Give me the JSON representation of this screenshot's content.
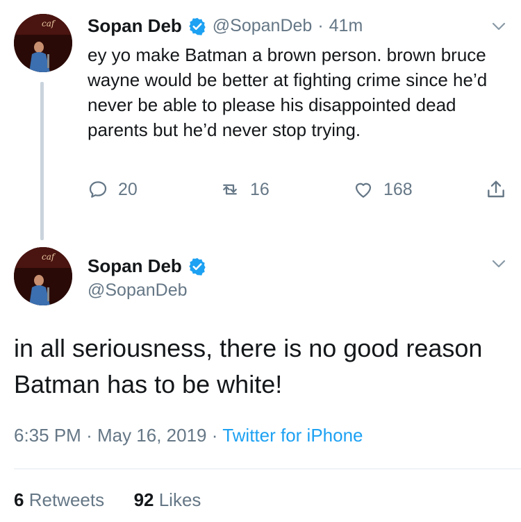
{
  "tweet1": {
    "name": "Sopan Deb",
    "handle": "@SopanDeb",
    "separator": "·",
    "time": "41m",
    "text": "ey yo make Batman a brown person. brown bruce wayne would be better at fighting crime since he’d never be able to please his disappointed dead parents but he’d never stop trying.",
    "replies": "20",
    "retweets": "16",
    "likes": "168"
  },
  "tweet2": {
    "name": "Sopan Deb",
    "handle": "@SopanDeb",
    "text": "in all seriousness, there is no good reason Batman has to be white!",
    "time": "6:35 PM",
    "sep1": "·",
    "date": "May 16, 2019",
    "sep2": "·",
    "source": "Twitter for iPhone",
    "retweet_count": "6",
    "retweet_label": "Retweets",
    "like_count": "92",
    "like_label": "Likes"
  },
  "colors": {
    "text": "#14171a",
    "secondary": "#657786",
    "link": "#1da1f2",
    "verified": "#1da1f2",
    "thread_line": "#c9d3dc"
  },
  "icons": {
    "verified": "verified-badge-icon",
    "chevron": "chevron-down-icon",
    "reply": "reply-icon",
    "retweet": "retweet-icon",
    "like": "heart-icon",
    "share": "share-icon"
  }
}
